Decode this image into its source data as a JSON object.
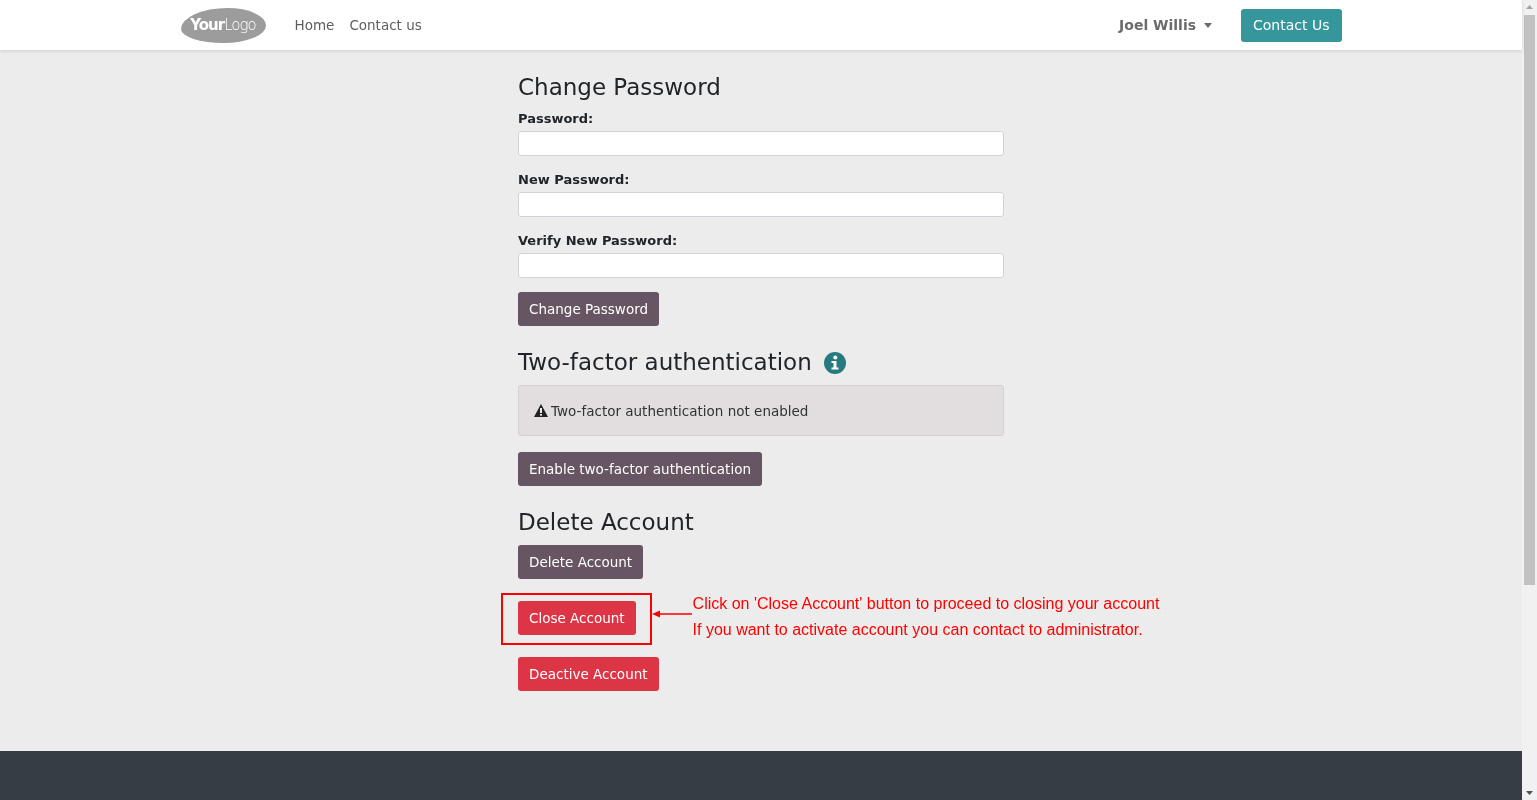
{
  "navbar": {
    "logo": "**Your**Logo",
    "links": [
      {
        "label": "Home"
      },
      {
        "label": "Contact us"
      }
    ],
    "user_menu": {
      "label": "Joel Willis"
    },
    "cta_button": "Contact Us"
  },
  "change_password": {
    "title": "Change Password",
    "fields": [
      {
        "label": "Password:"
      },
      {
        "label": "New Password:"
      },
      {
        "label": "Verify New Password:"
      }
    ],
    "submit_button": "Change Password"
  },
  "two_factor": {
    "title": "Two-factor authentication",
    "status_alert": "Two-factor authentication not enabled",
    "enable_button": "Enable two-factor authentication"
  },
  "delete_account": {
    "title": "Delete Account",
    "buttons": [
      {
        "label": "Delete Account",
        "kind": "secondary",
        "highlighted": false
      },
      {
        "label": "Close Account",
        "kind": "danger",
        "highlighted": true,
        "callout": [
          "Click on 'Close Account' button to proceed to closing your account",
          "If you want to activate account you can contact to administrator."
        ]
      },
      {
        "label": "Deactive Account",
        "kind": "danger",
        "highlighted": false
      }
    ]
  }
}
